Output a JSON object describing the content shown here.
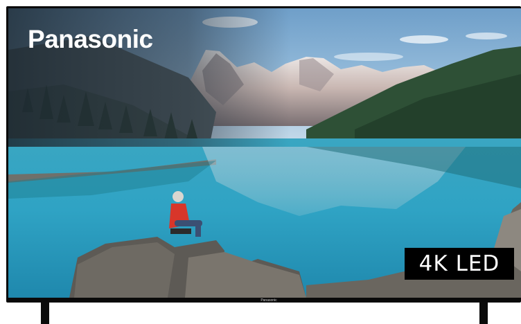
{
  "product": {
    "brand_logo": "Panasonic",
    "badge": "4K LED",
    "bezel_brand": "Panasonic"
  },
  "colors": {
    "bezel": "#0a0a0a",
    "lake": "#2fa3c4",
    "badge_background": "#000000"
  }
}
